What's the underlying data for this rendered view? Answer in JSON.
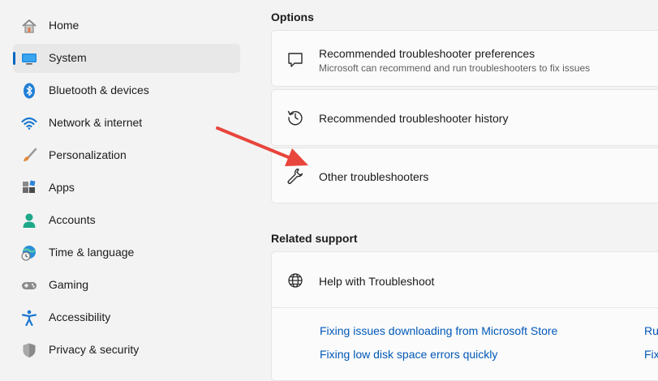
{
  "sidebar": {
    "items": [
      {
        "label": "Home",
        "icon": "home-icon"
      },
      {
        "label": "System",
        "icon": "system-icon",
        "selected": true
      },
      {
        "label": "Bluetooth & devices",
        "icon": "bluetooth-icon"
      },
      {
        "label": "Network & internet",
        "icon": "wifi-icon"
      },
      {
        "label": "Personalization",
        "icon": "brush-icon"
      },
      {
        "label": "Apps",
        "icon": "apps-icon"
      },
      {
        "label": "Accounts",
        "icon": "person-icon"
      },
      {
        "label": "Time & language",
        "icon": "globe-clock-icon"
      },
      {
        "label": "Gaming",
        "icon": "gamepad-icon"
      },
      {
        "label": "Accessibility",
        "icon": "accessibility-icon"
      },
      {
        "label": "Privacy & security",
        "icon": "shield-icon"
      }
    ]
  },
  "options": {
    "title": "Options",
    "items": [
      {
        "title": "Recommended troubleshooter preferences",
        "desc": "Microsoft can recommend and run troubleshooters to fix issues",
        "icon": "chat-bubble-icon"
      },
      {
        "title": "Recommended troubleshooter history",
        "icon": "history-icon"
      },
      {
        "title": "Other troubleshooters",
        "icon": "wrench-icon"
      }
    ]
  },
  "related": {
    "title": "Related support",
    "help_title": "Help with Troubleshoot",
    "help_icon": "globe-icon",
    "links": [
      "Fixing issues downloading from Microsoft Store",
      "Fixing low disk space errors quickly"
    ],
    "cut_links": [
      "Ru",
      "Fix"
    ]
  },
  "colors": {
    "accent": "#0067c0",
    "annotation_arrow": "#e8453c",
    "link": "#0058b8"
  }
}
